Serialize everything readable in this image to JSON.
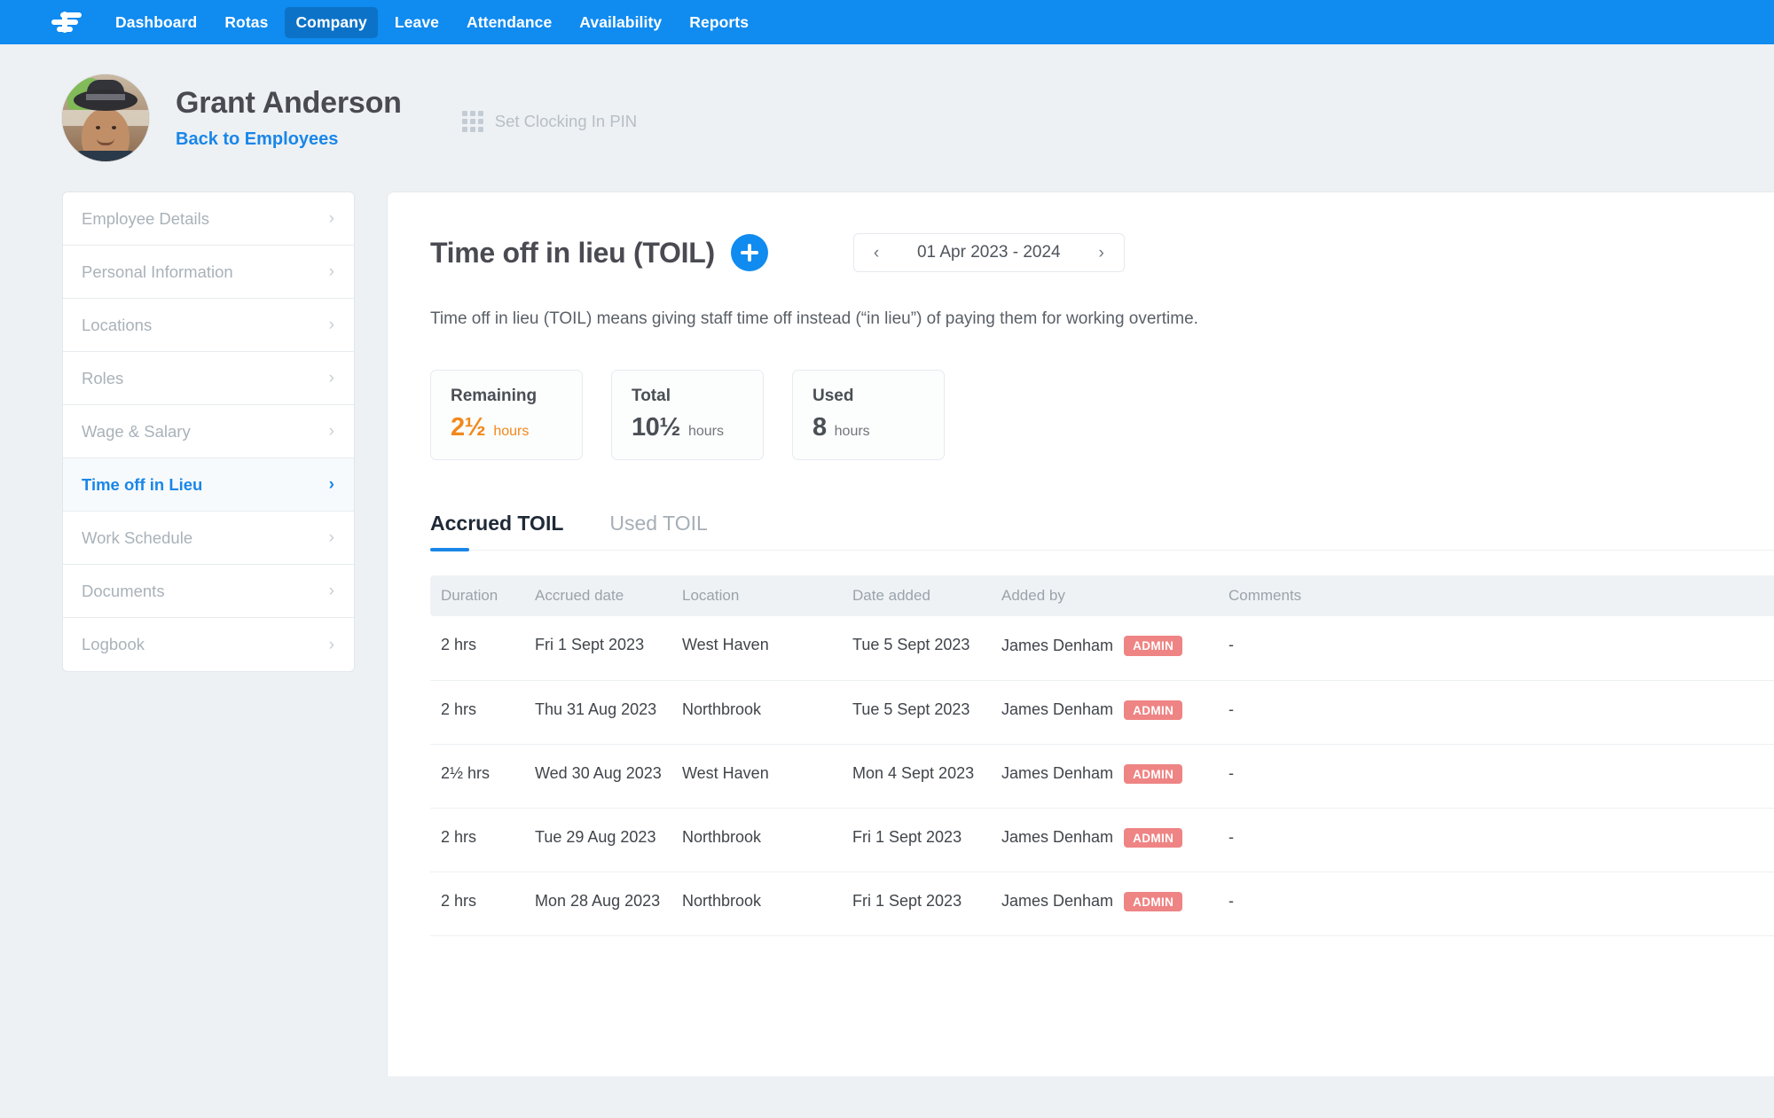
{
  "topnav": {
    "logo": "rotaready-logo-icon",
    "items": [
      {
        "label": "Dashboard",
        "active": false
      },
      {
        "label": "Rotas",
        "active": false
      },
      {
        "label": "Company",
        "active": true
      },
      {
        "label": "Leave",
        "active": false
      },
      {
        "label": "Attendance",
        "active": false
      },
      {
        "label": "Availability",
        "active": false
      },
      {
        "label": "Reports",
        "active": false
      }
    ],
    "accent_color": "#108bf0",
    "active_color": "#0b72c8"
  },
  "profile": {
    "name": "Grant Anderson",
    "back_link": "Back to Employees",
    "pin_button_label": "Set Clocking In PIN",
    "pin_icon": "keypad-grid-icon"
  },
  "sidebar": {
    "items": [
      {
        "label": "Employee Details",
        "active": false
      },
      {
        "label": "Personal Information",
        "active": false
      },
      {
        "label": "Locations",
        "active": false
      },
      {
        "label": "Roles",
        "active": false
      },
      {
        "label": "Wage & Salary",
        "active": false
      },
      {
        "label": "Time off in Lieu",
        "active": true
      },
      {
        "label": "Work Schedule",
        "active": false
      },
      {
        "label": "Documents",
        "active": false
      },
      {
        "label": "Logbook",
        "active": false
      }
    ],
    "chevron": "›"
  },
  "main": {
    "title": "Time off in lieu (TOIL)",
    "add_button": "+",
    "date_nav": {
      "prev": "‹",
      "label": "01 Apr 2023 - 2024",
      "next": "›"
    },
    "description": "Time off in lieu (TOIL) means giving staff time off instead (“in lieu”) of paying them for working overtime.",
    "stats": [
      {
        "label": "Remaining",
        "value": "2½",
        "unit": "hours",
        "highlight": true,
        "color": "#f2881b"
      },
      {
        "label": "Total",
        "value": "10½",
        "unit": "hours",
        "highlight": false
      },
      {
        "label": "Used",
        "value": "8",
        "unit": "hours",
        "highlight": false
      }
    ],
    "tabs": [
      {
        "label": "Accrued TOIL",
        "active": true
      },
      {
        "label": "Used TOIL",
        "active": false
      }
    ],
    "table": {
      "columns": [
        "Duration",
        "Accrued date",
        "Location",
        "Date added",
        "Added by",
        "Comments"
      ],
      "rows": [
        {
          "duration": "2 hrs",
          "accrued_date": "Fri 1 Sept 2023",
          "location": "West Haven",
          "date_added": "Tue 5 Sept 2023",
          "added_by": "James Denham",
          "badge": "ADMIN",
          "comments": "-"
        },
        {
          "duration": "2 hrs",
          "accrued_date": "Thu 31 Aug 2023",
          "location": "Northbrook",
          "date_added": "Tue 5 Sept 2023",
          "added_by": "James Denham",
          "badge": "ADMIN",
          "comments": "-"
        },
        {
          "duration": "2½ hrs",
          "accrued_date": "Wed 30 Aug 2023",
          "location": "West Haven",
          "date_added": "Mon 4 Sept 2023",
          "added_by": "James Denham",
          "badge": "ADMIN",
          "comments": "-"
        },
        {
          "duration": "2 hrs",
          "accrued_date": "Tue 29 Aug 2023",
          "location": "Northbrook",
          "date_added": "Fri 1 Sept 2023",
          "added_by": "James Denham",
          "badge": "ADMIN",
          "comments": "-"
        },
        {
          "duration": "2 hrs",
          "accrued_date": "Mon 28 Aug 2023",
          "location": "Northbrook",
          "date_added": "Fri 1 Sept 2023",
          "added_by": "James Denham",
          "badge": "ADMIN",
          "comments": "-"
        }
      ],
      "badge_color": "#ef8484"
    }
  }
}
